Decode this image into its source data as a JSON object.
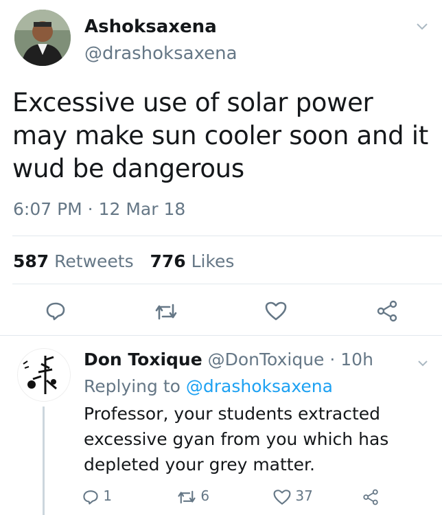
{
  "tweet": {
    "display_name": "Ashoksaxena",
    "handle": "@drashoksaxena",
    "text": "Excessive use of solar power may make sun cooler soon and it wud be dangerous",
    "timestamp": "6:07 PM · 12 Mar 18",
    "retweets_count": "587",
    "retweets_label": "Retweets",
    "likes_count": "776",
    "likes_label": "Likes"
  },
  "reply": {
    "display_name": "Don Toxique",
    "handle": "@DonToxique",
    "time": "· 10h",
    "replying_prefix": "Replying to",
    "replying_handle": "@drashoksaxena",
    "text": "Professor, your students extracted excessive gyan from you which has depleted your grey matter.",
    "reply_count": "1",
    "retweet_count": "6",
    "like_count": "37"
  },
  "icons": {
    "menu": "chevron-down-icon",
    "reply": "reply-icon",
    "retweet": "retweet-icon",
    "like": "heart-icon",
    "share": "share-icon"
  },
  "colors": {
    "link": "#1da1f2",
    "secondary_text": "#657786",
    "divider": "#e1e8ed"
  }
}
